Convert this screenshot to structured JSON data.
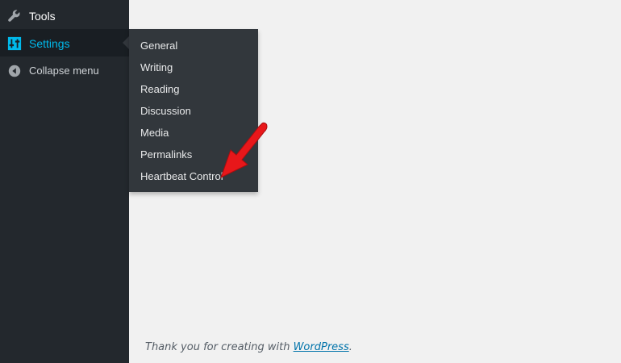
{
  "sidebar": {
    "items": [
      {
        "label": "Tools",
        "icon": "wrench-icon"
      },
      {
        "label": "Settings",
        "icon": "settings-sliders-icon"
      },
      {
        "label": "Collapse menu",
        "icon": "collapse-left-icon"
      }
    ]
  },
  "submenu": {
    "items": [
      {
        "label": "General"
      },
      {
        "label": "Writing"
      },
      {
        "label": "Reading"
      },
      {
        "label": "Discussion"
      },
      {
        "label": "Media"
      },
      {
        "label": "Permalinks"
      },
      {
        "label": "Heartbeat Control"
      }
    ]
  },
  "footer": {
    "text_before": "Thank you for creating with ",
    "link_text": "WordPress",
    "text_after": "."
  },
  "colors": {
    "sidebar_bg": "#23282d",
    "active_item_bg": "#191e23",
    "submenu_bg": "#32373c",
    "accent": "#00b9eb",
    "link": "#0073aa",
    "annotation_arrow": "#e8171a"
  }
}
